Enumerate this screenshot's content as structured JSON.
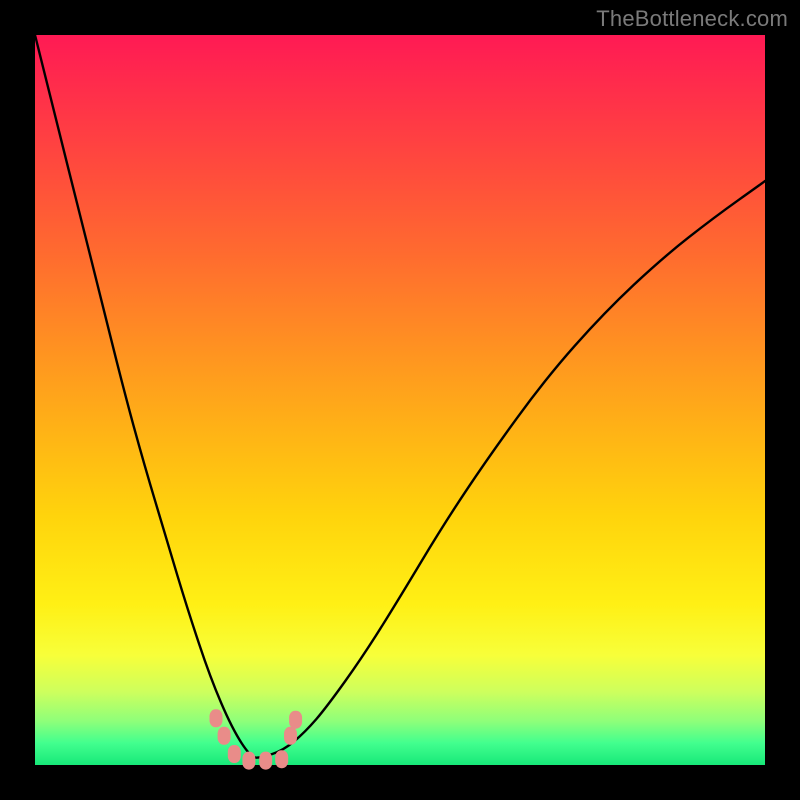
{
  "watermark": "TheBottleneck.com",
  "chart_data": {
    "type": "line",
    "title": "",
    "xlabel": "",
    "ylabel": "",
    "xlim": [
      0,
      1
    ],
    "ylim": [
      0,
      1
    ],
    "series": [
      {
        "name": "curve",
        "x": [
          0.0,
          0.03,
          0.06,
          0.09,
          0.12,
          0.15,
          0.18,
          0.21,
          0.24,
          0.27,
          0.296,
          0.31,
          0.34,
          0.37,
          0.4,
          0.45,
          0.5,
          0.56,
          0.62,
          0.7,
          0.78,
          0.86,
          0.93,
          1.0
        ],
        "y": [
          1.0,
          0.88,
          0.76,
          0.64,
          0.52,
          0.41,
          0.31,
          0.21,
          0.12,
          0.05,
          0.01,
          0.01,
          0.02,
          0.045,
          0.08,
          0.15,
          0.23,
          0.33,
          0.42,
          0.53,
          0.62,
          0.695,
          0.75,
          0.8
        ]
      }
    ],
    "markers": [
      {
        "name": "m1",
        "x": 0.248,
        "y": 0.064
      },
      {
        "name": "m2",
        "x": 0.259,
        "y": 0.04
      },
      {
        "name": "m3",
        "x": 0.273,
        "y": 0.015
      },
      {
        "name": "m4",
        "x": 0.293,
        "y": 0.006
      },
      {
        "name": "m5",
        "x": 0.316,
        "y": 0.006
      },
      {
        "name": "m6",
        "x": 0.338,
        "y": 0.008
      },
      {
        "name": "m7",
        "x": 0.35,
        "y": 0.04
      },
      {
        "name": "m8",
        "x": 0.357,
        "y": 0.062
      }
    ],
    "marker_color": "#e98c89",
    "curve_color": "#000000"
  }
}
